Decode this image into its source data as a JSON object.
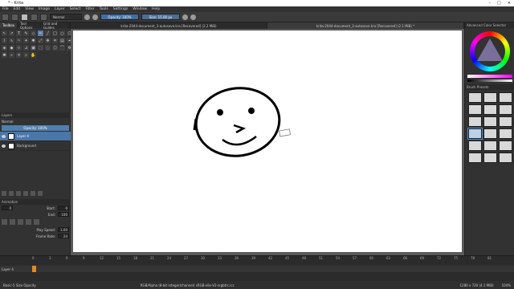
{
  "window": {
    "title": "* - Krita",
    "controls": [
      "–",
      "□",
      "✕"
    ]
  },
  "menu": [
    "File",
    "Edit",
    "View",
    "Image",
    "Layer",
    "Select",
    "Filter",
    "Tools",
    "Settings",
    "Window",
    "Help"
  ],
  "toolbar": {
    "blend_mode": "Normal",
    "opacity": "Opacity: 100%",
    "size": "Size: 15.00 px"
  },
  "left_tabs": [
    "Toolbox",
    "Tool Options",
    "Grid and Guides"
  ],
  "layers": {
    "title": "Layers",
    "blend_mode": "Normal",
    "opacity": "Opacity: 100%",
    "items": [
      {
        "name": "Layer 4",
        "selected": true
      },
      {
        "name": "Background",
        "selected": false
      }
    ]
  },
  "animation": {
    "title": "Animation",
    "current_frame": "0",
    "start_label": "Start:",
    "start_value": "0",
    "end_label": "End:",
    "end_value": "100",
    "play_speed_label": "Play Speed:",
    "play_speed_value": "1.00",
    "frame_rate_label": "Frame Rate:",
    "frame_rate_value": "24"
  },
  "doc_tabs": [
    "krita-2044-document_3-autosave.kra [Recovered] (2.2 MiB)",
    "krita-2044-document_3-autosave.kra [Recovered] (2.1 MiB) *"
  ],
  "right_panels": {
    "color_selector": "Advanced Color Selector",
    "brush_presets": "Brush Presets"
  },
  "timeline": {
    "ticks": [
      "0",
      "3",
      "6",
      "9",
      "12",
      "15",
      "18",
      "21",
      "24",
      "27",
      "30",
      "33",
      "36",
      "39",
      "42",
      "45",
      "48",
      "51",
      "54",
      "57",
      "60",
      "63",
      "66",
      "69",
      "72",
      "75",
      "78",
      "81"
    ],
    "layer_label": "Layer 4"
  },
  "status": {
    "left": "Basic-5 Size Opacity",
    "colorspace": "RGB/Alpha (8-bit integer/channel)  sRGB-elle-V2-srgbtrc.icc",
    "dimensions": "1280 x 720 (4.1 MiB)",
    "zoom": "104%"
  },
  "colors": {
    "accent": "#4a76a8",
    "timeline_cursor": "#e08a2a"
  }
}
